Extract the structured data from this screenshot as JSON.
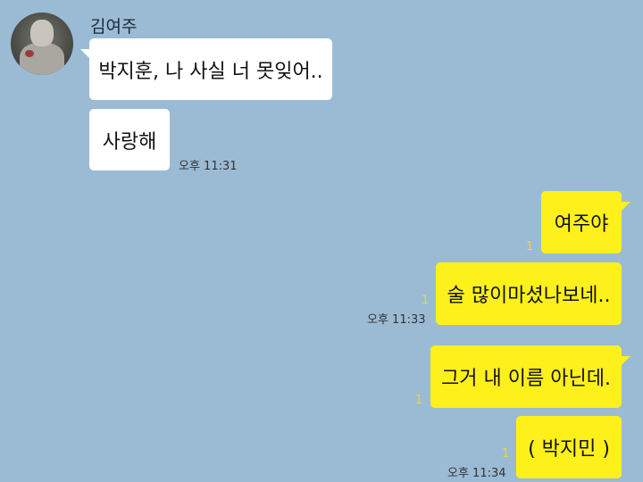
{
  "contact": {
    "name": "김여주",
    "avatar_icon": "profile-photo"
  },
  "incoming": [
    {
      "text": "박지훈, 나 사실 너 못잊어.."
    },
    {
      "text": "사랑해",
      "time": "오후 11:31"
    }
  ],
  "outgoing": [
    {
      "text": "여주야",
      "unread": "1"
    },
    {
      "text": "술 많이마셨나보네..",
      "unread": "1",
      "time": "오후 11:33"
    },
    {
      "text": "그거 내 이름 아닌데.",
      "unread": "1"
    },
    {
      "text": "( 박지민 )",
      "unread": "1",
      "time": "오후 11:34"
    }
  ],
  "colors": {
    "background": "#9bbbd4",
    "incoming_bubble": "#ffffff",
    "outgoing_bubble": "#fef01b",
    "unread_count": "#e8d93a"
  }
}
